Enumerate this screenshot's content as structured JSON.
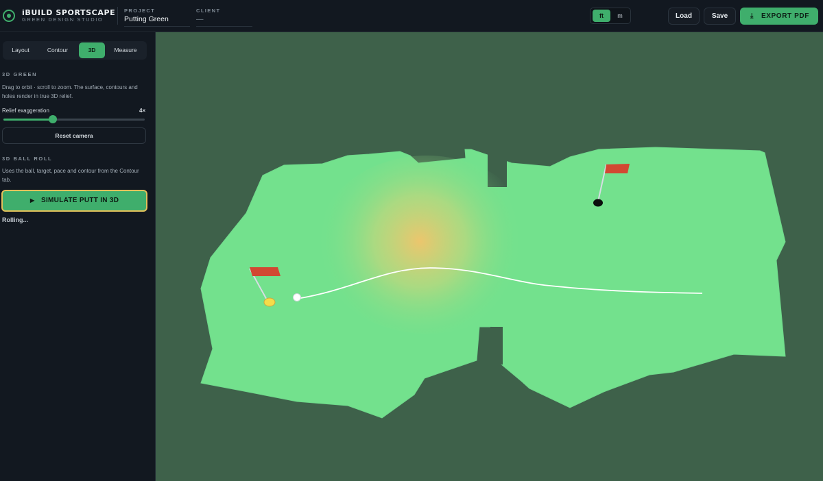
{
  "app": {
    "brand": "iBUILD SPORTSCAPE",
    "brand_sub": "GREEN DESIGN STUDIO"
  },
  "header": {
    "project_label": "PROJECT",
    "project_value": "Putting Green",
    "client_label": "CLIENT",
    "client_value": "—",
    "units": [
      {
        "label": "ft",
        "active": true
      },
      {
        "label": "m",
        "active": false
      }
    ],
    "load_label": "Load",
    "save_label": "Save",
    "export_label": "EXPORT PDF",
    "export_icon": "download-icon"
  },
  "sidebar": {
    "tabs": [
      {
        "label": "Layout",
        "active": false
      },
      {
        "label": "Contour",
        "active": false
      },
      {
        "label": "3D",
        "active": true
      },
      {
        "label": "Measure",
        "active": false
      }
    ],
    "green_title": "3D GREEN",
    "green_text": "Drag to orbit · scroll to zoom. The surface, contours and holes render in true 3D relief.",
    "relief_label": "Relief exaggeration",
    "relief_value": "4×",
    "relief_fraction": 0.35,
    "reset_label": "Reset camera",
    "roll_title": "3D BALL ROLL",
    "roll_text": "Uses the ball, target, pace and contour from the Contour tab.",
    "simulate_label": "SIMULATE PUTT IN 3D",
    "simulate_icon": "play-icon",
    "status": "Rolling..."
  },
  "scene": {
    "background": "#3e614a",
    "green_color": "#73e18d",
    "ridge_color": "#f2c46b",
    "flag_color": "#d24832",
    "ball_color": "#ffffff",
    "hole_color": "#0b0f0d",
    "target_color": "#f5dc4a",
    "path_color": "#ffffff"
  }
}
